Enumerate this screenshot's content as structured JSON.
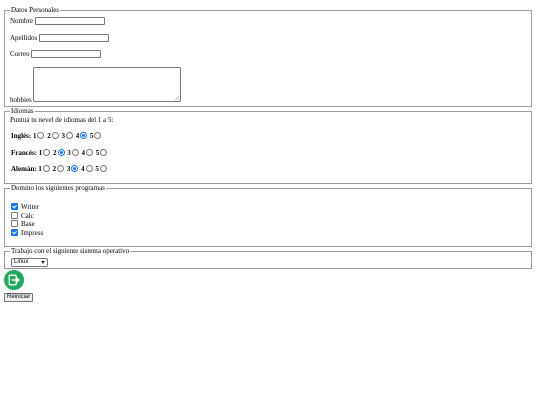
{
  "personal": {
    "legend": "Datos Personales",
    "name_label": "Nombre",
    "lastname_label": "Apellidos",
    "email_label": "Correo",
    "hobbies_label": "hobbies",
    "name_value": "",
    "lastname_value": "",
    "email_value": "",
    "hobbies_value": ""
  },
  "languages": {
    "legend": "Idiomas",
    "instruction": "Puntua tu nevel de idiomas del 1 a 5:",
    "scale": [
      "1",
      "2",
      "3",
      "4",
      "5"
    ],
    "rows": [
      {
        "label": "Inglés:",
        "selected": 4
      },
      {
        "label": "Francés:",
        "selected": 2
      },
      {
        "label": "Alemán:",
        "selected": 3
      }
    ]
  },
  "programs": {
    "legend": "Domino los siguientes programas",
    "items": [
      {
        "label": "Writer",
        "checked": true
      },
      {
        "label": "Calc",
        "checked": false
      },
      {
        "label": "Base",
        "checked": false
      },
      {
        "label": "Impress",
        "checked": true
      }
    ]
  },
  "os": {
    "legend": "Trabajo con el siguiente sistema operativo",
    "selected": "Linux"
  },
  "actions": {
    "submit_icon": "exit-icon",
    "submit_color": "#22a861",
    "reset_label": "Reiniciar"
  },
  "accent_color": "#1a73e8"
}
